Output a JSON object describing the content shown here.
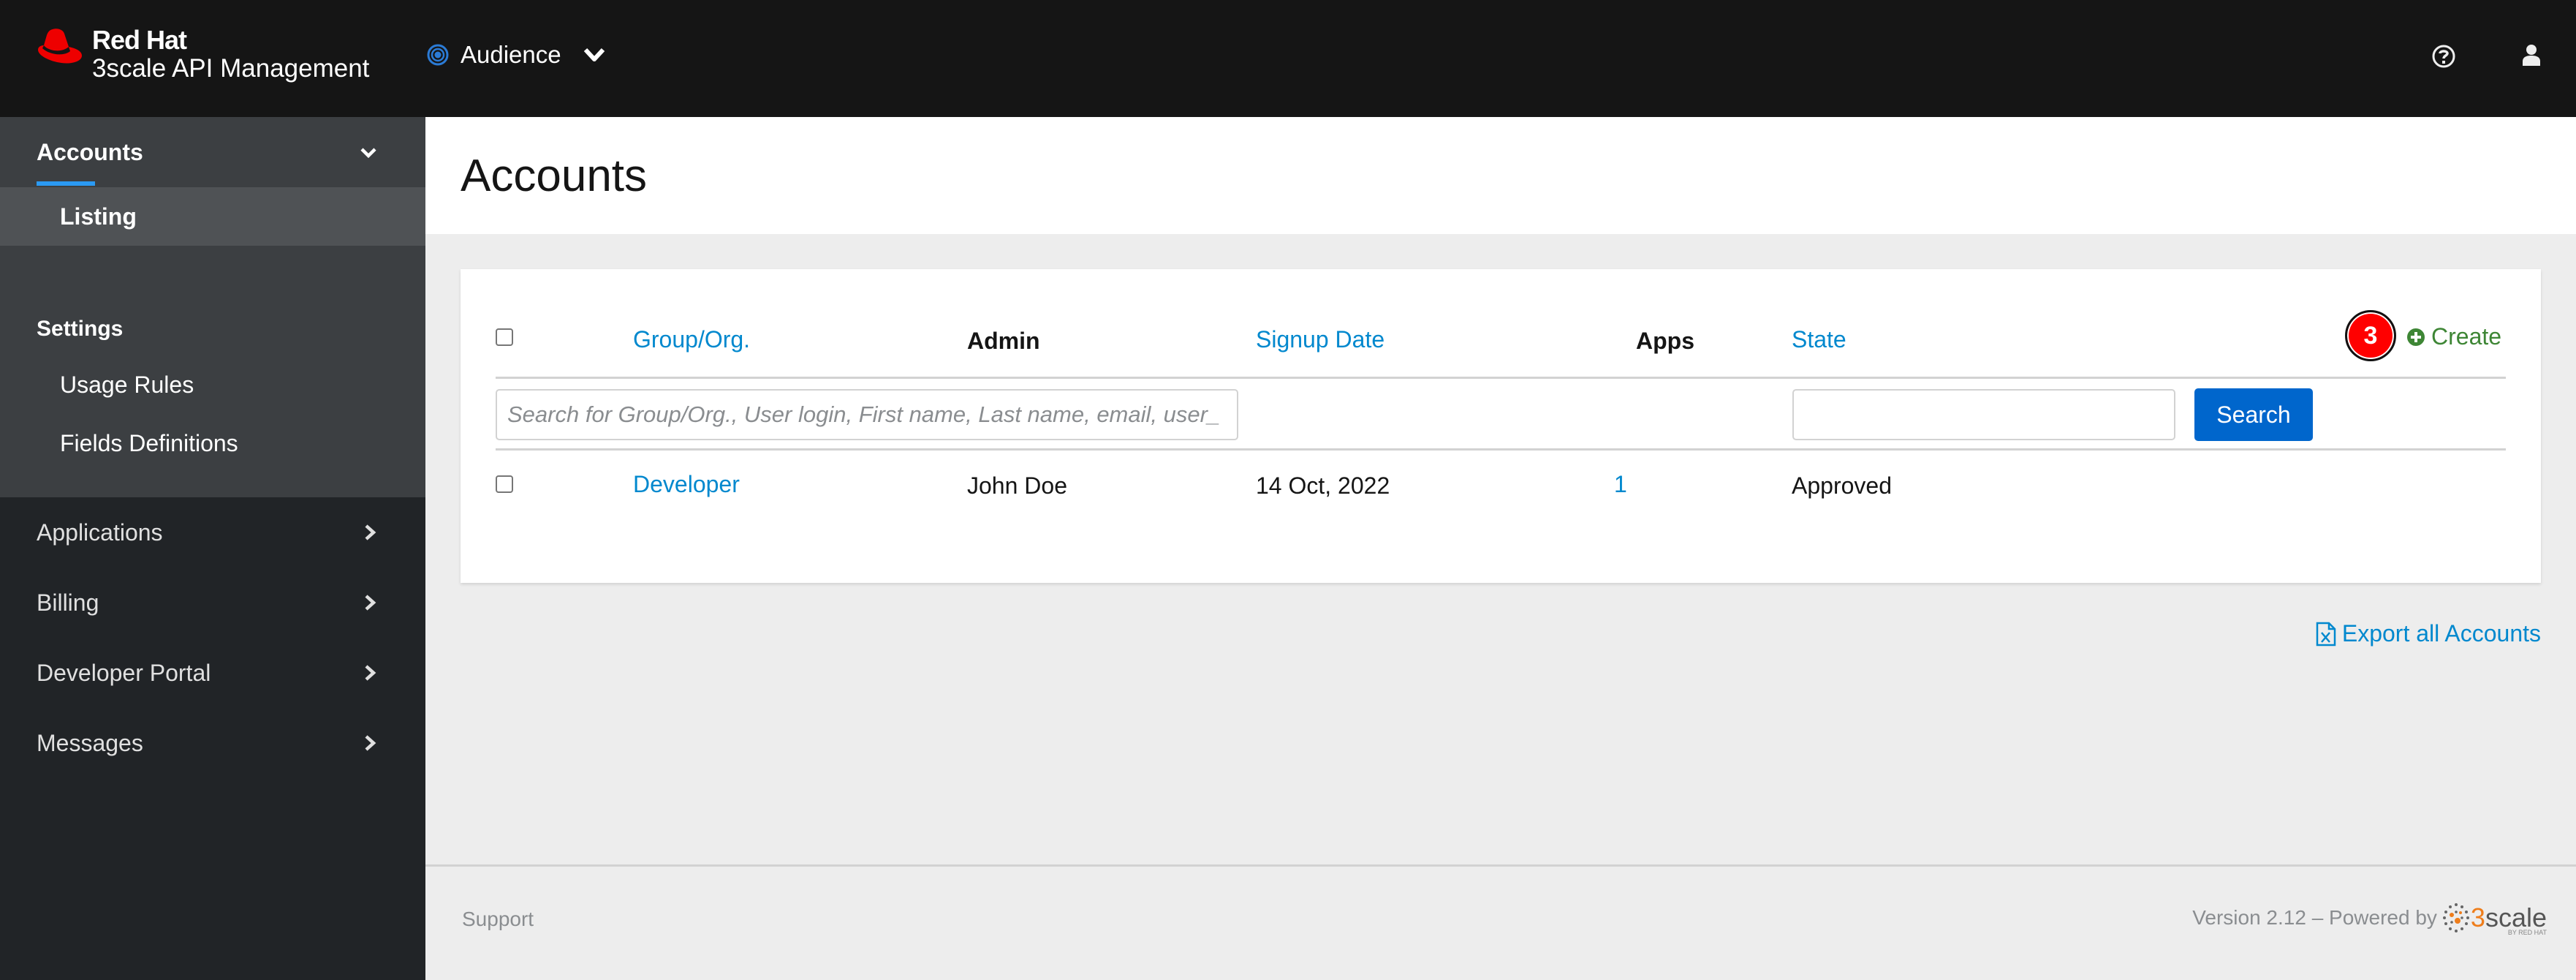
{
  "header": {
    "brand_line1": "Red Hat",
    "brand_line2": "3scale API Management",
    "context_label": "Audience",
    "icons": {
      "context": "target-icon",
      "context_toggle": "chevron-down-icon",
      "help": "help-icon",
      "user": "user-icon"
    }
  },
  "sidebar": {
    "group": {
      "label": "Accounts",
      "expanded": true
    },
    "sub_items": [
      {
        "label": "Listing",
        "active": true
      }
    ],
    "section_title": "Settings",
    "settings_items": [
      {
        "label": "Usage Rules"
      },
      {
        "label": "Fields Definitions"
      }
    ],
    "items": [
      {
        "label": "Applications"
      },
      {
        "label": "Billing"
      },
      {
        "label": "Developer Portal"
      },
      {
        "label": "Messages"
      }
    ]
  },
  "page": {
    "title": "Accounts"
  },
  "table": {
    "columns": [
      {
        "label": "Group/Org.",
        "sortable": true
      },
      {
        "label": "Admin",
        "sortable": false
      },
      {
        "label": "Signup Date",
        "sortable": true
      },
      {
        "label": "Apps",
        "sortable": false
      },
      {
        "label": "State",
        "sortable": true
      }
    ],
    "annotation_marker": "3",
    "create_label": "Create",
    "search": {
      "query_placeholder": "Search for Group/Org., User login, First name, Last name, email, user_",
      "query_value": "",
      "state_value": "",
      "button_label": "Search"
    },
    "rows": [
      {
        "group": "Developer",
        "admin": "John Doe",
        "signup_date": "14 Oct, 2022",
        "apps": "1",
        "state": "Approved"
      }
    ]
  },
  "export_label": "Export all Accounts",
  "footer": {
    "support_label": "Support",
    "version_text": "Version 2.12 – Powered by",
    "powered_logo_three": "3",
    "powered_logo_scale": "scale",
    "powered_logo_by": "BY RED HAT"
  },
  "colors": {
    "masthead": "#151515",
    "sidebar": "#212427",
    "link": "#0088ce",
    "primary_button": "#0066cc",
    "create": "#3e8635",
    "nav_active_bar": "#2b9af3",
    "brand_red": "#ee0000"
  }
}
